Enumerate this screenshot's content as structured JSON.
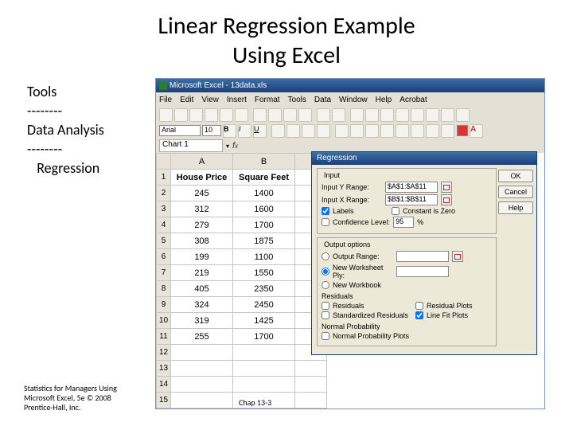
{
  "title_line1": "Linear Regression Example",
  "title_line2": "Using Excel",
  "steps": {
    "l1": "Tools",
    "l2": "--------",
    "l3": "Data Analysis",
    "l4": "--------",
    "l5": "   Regression"
  },
  "excel": {
    "titlebar": "Microsoft Excel - 13data.xls",
    "menu": [
      "File",
      "Edit",
      "View",
      "Insert",
      "Format",
      "Tools",
      "Data",
      "Window",
      "Help",
      "Acrobat"
    ],
    "font": "Arial",
    "size": "10",
    "namebox": "Chart 1",
    "columns": [
      "A",
      "B"
    ],
    "headers": [
      "House Price",
      "Square Feet"
    ],
    "rows": [
      [
        "245",
        "1400"
      ],
      [
        "312",
        "1600"
      ],
      [
        "279",
        "1700"
      ],
      [
        "308",
        "1875"
      ],
      [
        "199",
        "1100"
      ],
      [
        "219",
        "1550"
      ],
      [
        "405",
        "2350"
      ],
      [
        "324",
        "2450"
      ],
      [
        "319",
        "1425"
      ],
      [
        "255",
        "1700"
      ]
    ]
  },
  "dlg": {
    "title": "Regression",
    "input_legend": "Input",
    "y_label": "Input Y Range:",
    "y_value": "$A$1:$A$11",
    "x_label": "Input X Range:",
    "x_value": "$B$1:$B$11",
    "labels": "Labels",
    "const_zero": "Constant is Zero",
    "conf": "Confidence Level:",
    "conf_val": "95",
    "conf_pct": "%",
    "output_legend": "Output options",
    "out_range": "Output Range:",
    "out_ws": "New Worksheet Ply:",
    "out_wb": "New Workbook",
    "resid_legend": "Residuals",
    "resid": "Residuals",
    "resid_plots": "Residual Plots",
    "std_resid": "Standardized Residuals",
    "line_fit": "Line Fit Plots",
    "np_legend": "Normal Probability",
    "np": "Normal Probability Plots",
    "ok": "OK",
    "cancel": "Cancel",
    "help": "Help"
  },
  "footer": {
    "left_l1": "Statistics for Managers Using",
    "left_l2": "Microsoft Excel, 5e © 2008",
    "left_l3": "Prentice-Hall, Inc.",
    "center": "Chap 13-3"
  }
}
